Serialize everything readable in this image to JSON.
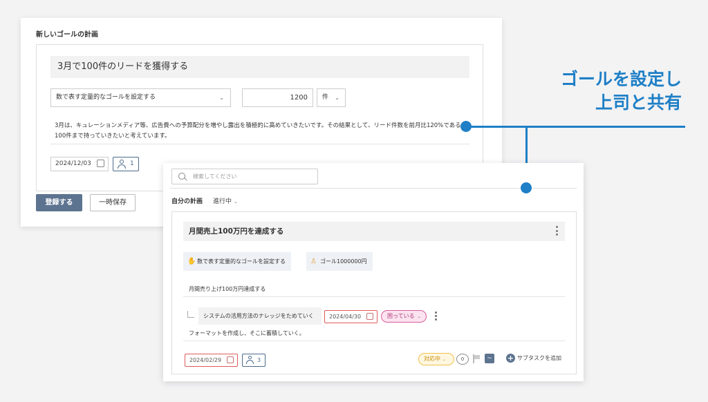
{
  "plan_form": {
    "title": "新しいゴールの計画",
    "goal_title": "3月で100件のリードを獲得する",
    "goal_type_select": "数で表す定量的なゴールを設定する",
    "target_value": "1200",
    "unit_select": "件",
    "description": "3月は、キュレーションメディア等、広告費への予算配分を増やし露出を積極的に高めていきたいです。その結果として、リード件数を前月比120%である100件まで持っていきたいと考えています。",
    "due_date": "2024/12/03",
    "assignee_count": "1",
    "register_button": "登録する",
    "draft_button": "一時保存"
  },
  "headline": {
    "line1": "ゴールを設定し",
    "line2": "上司と共有"
  },
  "plan_list": {
    "search_placeholder": "検索してください",
    "section_title": "自分の計画",
    "status_filter": "進行中",
    "plan": {
      "title": "月間売上100万円を達成する",
      "goal_type_chip": "数で表す定量的なゴールを設定する",
      "goal_chip": "ゴール1000000円",
      "summary": "月間売り上げ100万円達成する",
      "subtask": {
        "name": "システムの活用方法のナレッジをためていく",
        "due_date": "2024/04/30",
        "status": "困っている",
        "description": "フォーマットを作成し、そこに蓄積していく。"
      },
      "due_date": "2024/02/29",
      "assignee_count": "3",
      "status": "対応中",
      "comment_count": "0",
      "add_subtask_label": "サブタスクを追加"
    }
  },
  "colors": {
    "accent_blue": "#1e7fc6",
    "primary_button": "#5d7490",
    "trouble_pink": "#d85b9c",
    "progress_yellow": "#f0c04a",
    "date_red": "#e05a5a"
  }
}
